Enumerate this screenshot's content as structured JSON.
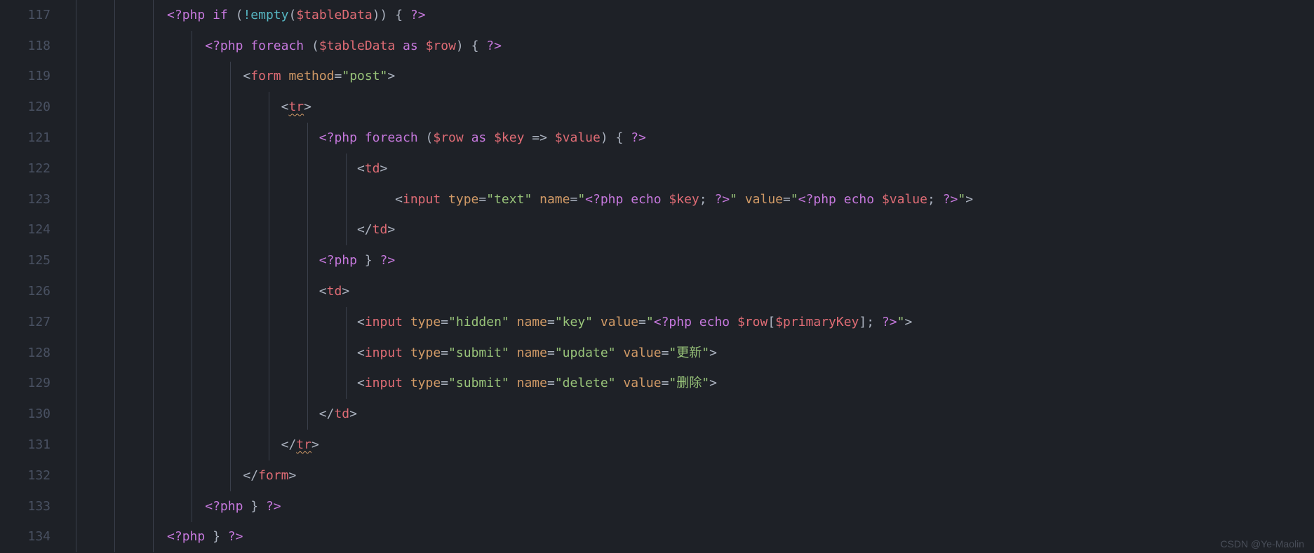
{
  "lineStart": 117,
  "lines": [
    117,
    118,
    119,
    120,
    121,
    122,
    123,
    124,
    125,
    126,
    127,
    128,
    129,
    130,
    131,
    132,
    133,
    134
  ],
  "watermark": "CSDN @Ye-Maolin",
  "code": {
    "l117": {
      "php_open": "<?php",
      "kw_if": "if",
      "op_not": "!",
      "fn_empty": "empty",
      "var": "$tableData",
      "php_close": "?>"
    },
    "l118": {
      "php_open": "<?php",
      "kw_foreach": "foreach",
      "var1": "$tableData",
      "kw_as": "as",
      "var2": "$row",
      "php_close": "?>"
    },
    "l119": {
      "tag": "form",
      "attr": "method",
      "val": "post"
    },
    "l120": {
      "tag": "tr"
    },
    "l121": {
      "php_open": "<?php",
      "kw_foreach": "foreach",
      "var1": "$row",
      "kw_as": "as",
      "var2": "$key",
      "arrow": "=>",
      "var3": "$value",
      "php_close": "?>"
    },
    "l122": {
      "tag": "td"
    },
    "l123": {
      "tag": "input",
      "a1": "type",
      "v1": "text",
      "a2": "name",
      "php_open": "<?php",
      "echo1": "echo",
      "var1": "$key",
      "php_close": "?>",
      "a3": "value",
      "echo2": "echo",
      "var2": "$value"
    },
    "l124": {
      "tag": "td"
    },
    "l125": {
      "php_open": "<?php",
      "php_close": "?>"
    },
    "l126": {
      "tag": "td"
    },
    "l127": {
      "tag": "input",
      "a1": "type",
      "v1": "hidden",
      "a2": "name",
      "v2": "key",
      "a3": "value",
      "php_open": "<?php",
      "echo": "echo",
      "var1": "$row",
      "var2": "$primaryKey",
      "php_close": "?>"
    },
    "l128": {
      "tag": "input",
      "a1": "type",
      "v1": "submit",
      "a2": "name",
      "v2": "update",
      "a3": "value",
      "v3": "更新"
    },
    "l129": {
      "tag": "input",
      "a1": "type",
      "v1": "submit",
      "a2": "name",
      "v2": "delete",
      "a3": "value",
      "v3": "删除"
    },
    "l130": {
      "tag": "td"
    },
    "l131": {
      "tag": "tr"
    },
    "l132": {
      "tag": "form"
    },
    "l133": {
      "php_open": "<?php",
      "php_close": "?>"
    },
    "l134": {
      "php_open": "<?php",
      "php_close": "?>"
    }
  }
}
